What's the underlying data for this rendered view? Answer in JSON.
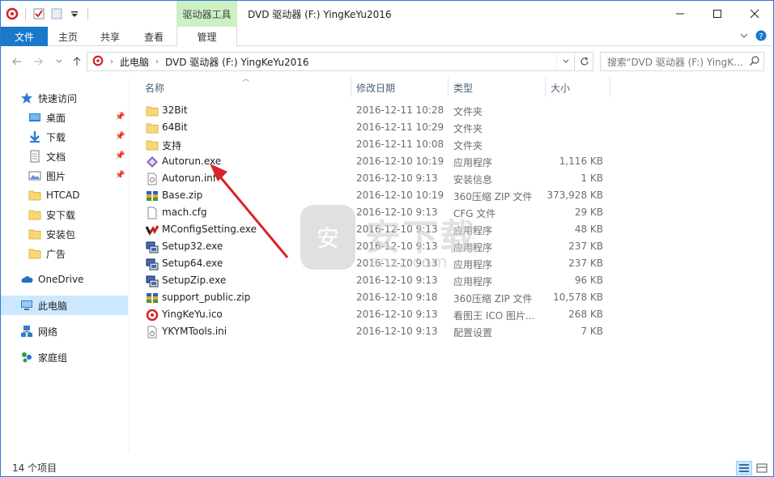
{
  "titlebar": {
    "context_tab": "驱动器工具",
    "title": "DVD 驱动器 (F:) YingKeYu2016"
  },
  "ribbon": {
    "tabs": [
      "文件",
      "主页",
      "共享",
      "查看",
      "管理"
    ]
  },
  "address": {
    "crumbs": [
      "此电脑",
      "DVD 驱动器 (F:) YingKeYu2016"
    ],
    "search_placeholder": "搜索\"DVD 驱动器 (F:) YingK...",
    "search_hint": "搜索\"DVD 驱动器 (F:) YingK..."
  },
  "sidebar": {
    "quick_access": "快速访问",
    "items": [
      {
        "label": "桌面",
        "icon": "desktop-icon",
        "pinned": true
      },
      {
        "label": "下载",
        "icon": "download-icon",
        "pinned": true
      },
      {
        "label": "文档",
        "icon": "documents-icon",
        "pinned": true
      },
      {
        "label": "图片",
        "icon": "pictures-icon",
        "pinned": true
      },
      {
        "label": "HTCAD",
        "icon": "folder-icon",
        "pinned": false
      },
      {
        "label": "安下载",
        "icon": "folder-icon",
        "pinned": false
      },
      {
        "label": "安装包",
        "icon": "folder-icon",
        "pinned": false
      },
      {
        "label": "广告",
        "icon": "folder-icon",
        "pinned": false
      }
    ],
    "onedrive": "OneDrive",
    "this_pc": "此电脑",
    "network": "网络",
    "homegroup": "家庭组"
  },
  "columns": {
    "name": "名称",
    "date": "修改日期",
    "type": "类型",
    "size": "大小"
  },
  "files": [
    {
      "name": "32Bit",
      "date": "2016-12-11 10:28",
      "type": "文件夹",
      "size": "",
      "icon": "folder-icon"
    },
    {
      "name": "64Bit",
      "date": "2016-12-11 10:29",
      "type": "文件夹",
      "size": "",
      "icon": "folder-icon"
    },
    {
      "name": "支持",
      "date": "2016-12-11 10:08",
      "type": "文件夹",
      "size": "",
      "icon": "folder-icon"
    },
    {
      "name": "Autorun.exe",
      "date": "2016-12-10 10:19",
      "type": "应用程序",
      "size": "1,116 KB",
      "icon": "autorun-exe-icon"
    },
    {
      "name": "Autorun.inf",
      "date": "2016-12-10 9:13",
      "type": "安装信息",
      "size": "1 KB",
      "icon": "inf-file-icon"
    },
    {
      "name": "Base.zip",
      "date": "2016-12-10 10:19",
      "type": "360压缩 ZIP 文件",
      "size": "373,928 KB",
      "icon": "zip-icon"
    },
    {
      "name": "mach.cfg",
      "date": "2016-12-10 9:13",
      "type": "CFG 文件",
      "size": "29 KB",
      "icon": "cfg-file-icon"
    },
    {
      "name": "MConfigSetting.exe",
      "date": "2016-12-10 9:13",
      "type": "应用程序",
      "size": "48 KB",
      "icon": "mconfig-exe-icon"
    },
    {
      "name": "Setup32.exe",
      "date": "2016-12-10 9:13",
      "type": "应用程序",
      "size": "237 KB",
      "icon": "setup-icon"
    },
    {
      "name": "Setup64.exe",
      "date": "2016-12-10 9:13",
      "type": "应用程序",
      "size": "237 KB",
      "icon": "setup-icon"
    },
    {
      "name": "SetupZip.exe",
      "date": "2016-12-10 9:13",
      "type": "应用程序",
      "size": "96 KB",
      "icon": "setup-icon"
    },
    {
      "name": "support_public.zip",
      "date": "2016-12-10 9:18",
      "type": "360压缩 ZIP 文件",
      "size": "10,578 KB",
      "icon": "zip-icon"
    },
    {
      "name": "YingKeYu.ico",
      "date": "2016-12-10 9:13",
      "type": "看图王 ICO 图片...",
      "size": "268 KB",
      "icon": "ico-file-icon"
    },
    {
      "name": "YKYMTools.ini",
      "date": "2016-12-10 9:13",
      "type": "配置设置",
      "size": "7 KB",
      "icon": "ini-file-icon"
    }
  ],
  "watermark": {
    "text": "安下载",
    "sub": "anxz.com"
  },
  "status": {
    "count": "14 个项目"
  },
  "colors": {
    "accent": "#1979ca",
    "context_tab": "#ccf0c4",
    "selection": "#cce8ff",
    "arrow": "#d9252a"
  }
}
